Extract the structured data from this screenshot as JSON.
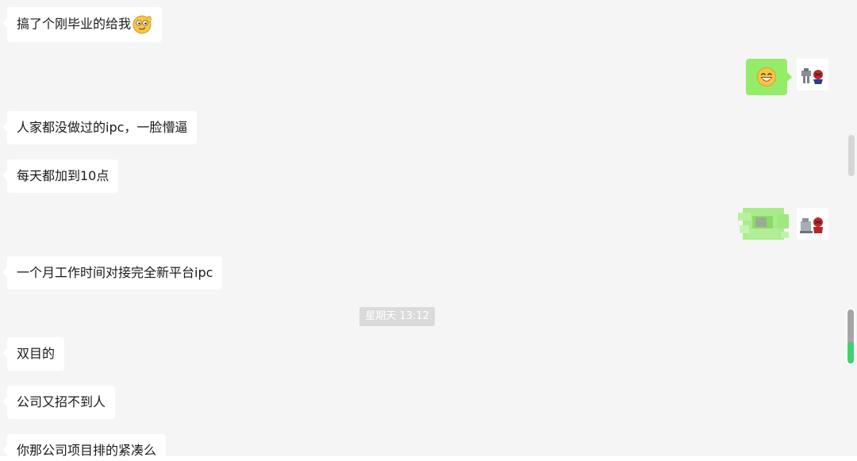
{
  "messages": {
    "m1": {
      "text": "搞了个刚毕业的给我",
      "emoji": "smirk-face-emoji"
    },
    "m2": {
      "text": "人家都没做过的ipc，一脸懵逼"
    },
    "m3": {
      "text": "每天都加到10点"
    },
    "m4": {
      "text": "一个月工作时间对接完全新平台ipc"
    },
    "m5": {
      "text": "双目的"
    },
    "m6": {
      "text": "公司又招不到人"
    },
    "m7": {
      "text": "你那公司项目排的紧凑么"
    }
  },
  "outgoing": {
    "o1": {
      "emoji": "grin-face-emoji"
    },
    "o2": {
      "content": "blurred"
    }
  },
  "timestamp": {
    "label": "星期天 13:12"
  },
  "scroll_progress": 0.4,
  "colors": {
    "background": "#f5f5f5",
    "incoming_bubble": "#ffffff",
    "outgoing_bubble": "#95ec69",
    "timestamp_bg": "#dadada",
    "scroll_accent": "#3ed36a"
  }
}
